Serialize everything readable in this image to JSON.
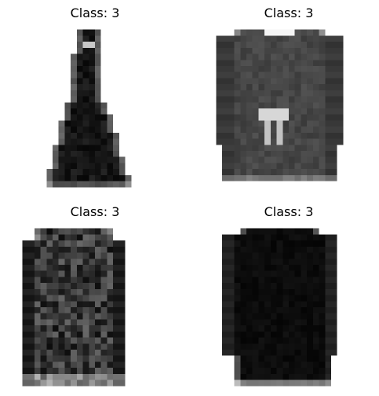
{
  "figure": {
    "panels": [
      {
        "title": "Class: 3",
        "subject": "sleeveless-dress"
      },
      {
        "title": "Class: 3",
        "subject": "long-sleeve-dress"
      },
      {
        "title": "Class: 3",
        "subject": "patterned-long-sleeve-dress"
      },
      {
        "title": "Class: 3",
        "subject": "black-long-sleeve-dress"
      }
    ],
    "colors": {
      "background": "#ffffff",
      "text": "#000000",
      "pixel_dark": "#0a0a0a",
      "pixel_light": "#ffffff"
    }
  }
}
